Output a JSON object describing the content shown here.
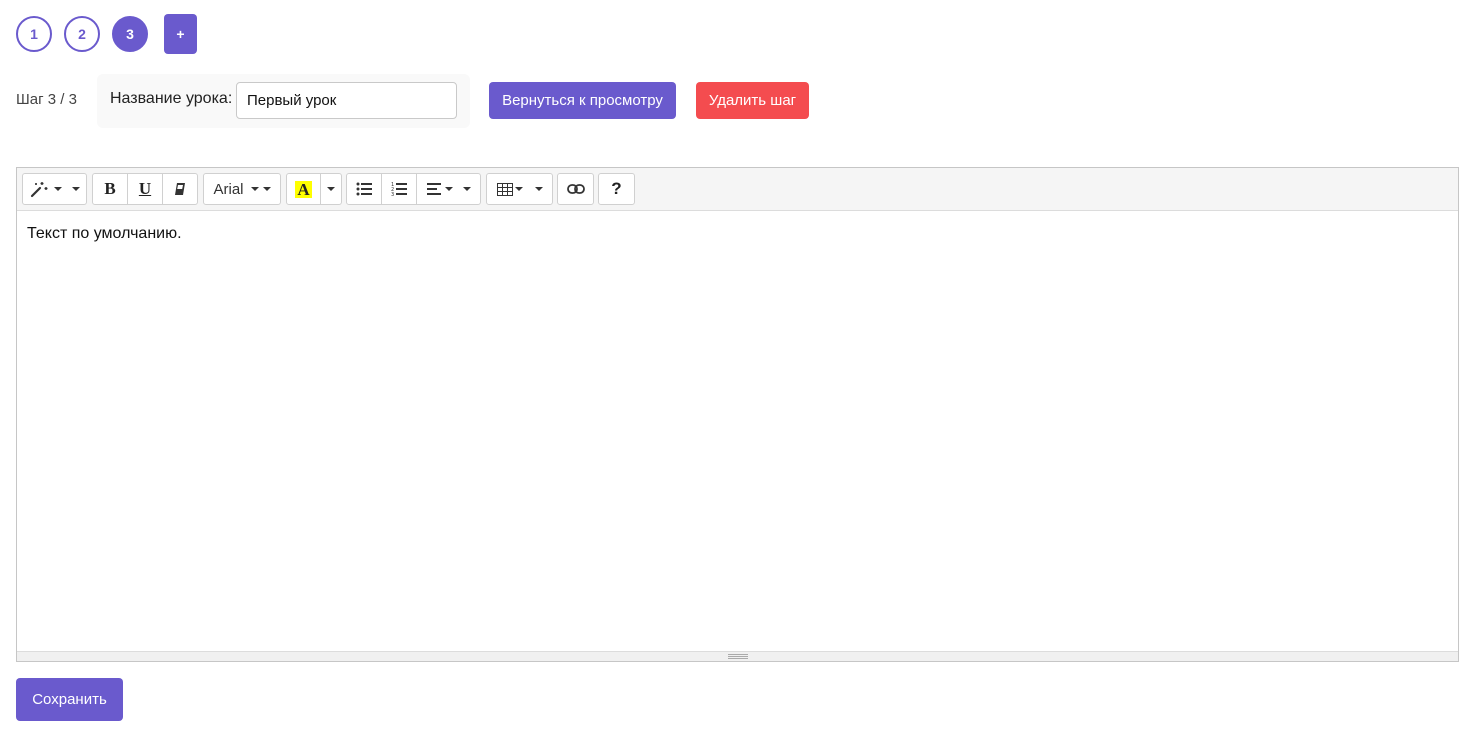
{
  "steps": {
    "items": [
      "1",
      "2",
      "3"
    ],
    "active_index": 2,
    "add_label": "+"
  },
  "lesson": {
    "step_counter": "Шаг 3 / 3",
    "title_label": "Название урока:",
    "title_value": "Первый урок"
  },
  "actions": {
    "back_label": "Вернуться к просмотру",
    "delete_label": "Удалить шаг",
    "save_label": "Сохранить"
  },
  "toolbar": {
    "style_icon": "magic-wand-icon",
    "bold_label": "B",
    "underline_label": "U",
    "eraser_icon": "eraser-icon",
    "font_name": "Arial",
    "color_label": "A",
    "highlight_color": "#ffff00",
    "ul_icon": "unordered-list-icon",
    "ol_icon": "ordered-list-icon",
    "align_icon": "align-left-icon",
    "table_icon": "table-icon",
    "link_icon": "link-icon",
    "help_label": "?"
  },
  "editor": {
    "content": "Текст по умолчанию."
  },
  "colors": {
    "primary": "#6a5acd",
    "danger": "#f44c4f"
  }
}
